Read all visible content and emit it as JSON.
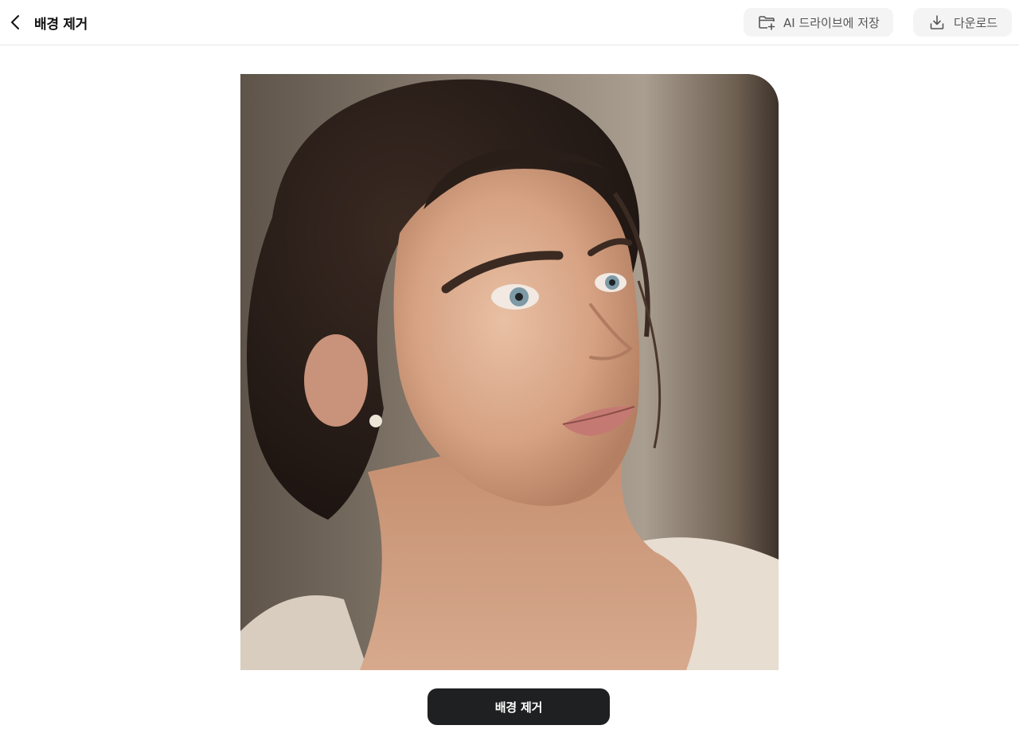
{
  "header": {
    "title": "배경 제거",
    "back_icon": "chevron-left-icon",
    "save_button": {
      "label": "AI 드라이브에 저장",
      "icon": "folder-plus-icon"
    },
    "download_button": {
      "label": "다운로드",
      "icon": "download-icon"
    }
  },
  "main": {
    "action_button": {
      "label": "배경 제거"
    }
  },
  "colors": {
    "button_dark": "#1f2021",
    "button_light": "#f4f4f5",
    "divider": "#e6e6e6"
  }
}
